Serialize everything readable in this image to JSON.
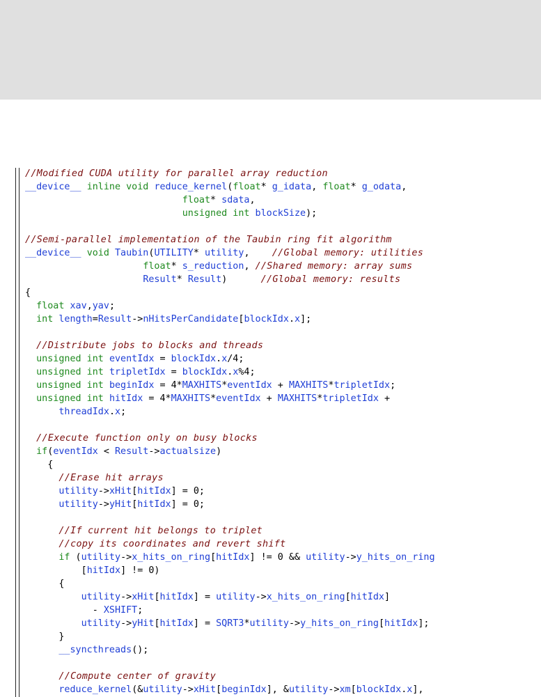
{
  "code": {
    "lines": [
      [
        {
          "c": "cmt",
          "t": "//Modified CUDA utility for parallel array reduction"
        }
      ],
      [
        {
          "c": "id",
          "t": "__device__"
        },
        {
          "c": "tx",
          "t": " "
        },
        {
          "c": "kw",
          "t": "inline void"
        },
        {
          "c": "tx",
          "t": " "
        },
        {
          "c": "id",
          "t": "reduce_kernel"
        },
        {
          "c": "tx",
          "t": "("
        },
        {
          "c": "kw",
          "t": "float"
        },
        {
          "c": "tx",
          "t": "* "
        },
        {
          "c": "id",
          "t": "g_idata"
        },
        {
          "c": "tx",
          "t": ", "
        },
        {
          "c": "kw",
          "t": "float"
        },
        {
          "c": "tx",
          "t": "* "
        },
        {
          "c": "id",
          "t": "g_odata"
        },
        {
          "c": "tx",
          "t": ","
        }
      ],
      [
        {
          "c": "tx",
          "t": "                            "
        },
        {
          "c": "kw",
          "t": "float"
        },
        {
          "c": "tx",
          "t": "* "
        },
        {
          "c": "id",
          "t": "sdata"
        },
        {
          "c": "tx",
          "t": ","
        }
      ],
      [
        {
          "c": "tx",
          "t": "                            "
        },
        {
          "c": "kw",
          "t": "unsigned int"
        },
        {
          "c": "tx",
          "t": " "
        },
        {
          "c": "id",
          "t": "blockSize"
        },
        {
          "c": "tx",
          "t": ");"
        }
      ],
      [],
      [
        {
          "c": "cmt",
          "t": "//Semi-parallel implementation of the Taubin ring fit algorithm"
        }
      ],
      [
        {
          "c": "id",
          "t": "__device__"
        },
        {
          "c": "tx",
          "t": " "
        },
        {
          "c": "kw",
          "t": "void"
        },
        {
          "c": "tx",
          "t": " "
        },
        {
          "c": "id",
          "t": "Taubin"
        },
        {
          "c": "tx",
          "t": "("
        },
        {
          "c": "id",
          "t": "UTILITY"
        },
        {
          "c": "tx",
          "t": "* "
        },
        {
          "c": "id",
          "t": "utility"
        },
        {
          "c": "tx",
          "t": ",    "
        },
        {
          "c": "cmt",
          "t": "//Global memory: utilities"
        }
      ],
      [
        {
          "c": "tx",
          "t": "                     "
        },
        {
          "c": "kw",
          "t": "float"
        },
        {
          "c": "tx",
          "t": "* "
        },
        {
          "c": "id",
          "t": "s_reduction"
        },
        {
          "c": "tx",
          "t": ", "
        },
        {
          "c": "cmt",
          "t": "//Shared memory: array sums"
        }
      ],
      [
        {
          "c": "tx",
          "t": "                     "
        },
        {
          "c": "id",
          "t": "Result"
        },
        {
          "c": "tx",
          "t": "* "
        },
        {
          "c": "id",
          "t": "Result"
        },
        {
          "c": "tx",
          "t": ")      "
        },
        {
          "c": "cmt",
          "t": "//Global memory: results"
        }
      ],
      [
        {
          "c": "tx",
          "t": "{"
        }
      ],
      [
        {
          "c": "tx",
          "t": "  "
        },
        {
          "c": "kw",
          "t": "float"
        },
        {
          "c": "tx",
          "t": " "
        },
        {
          "c": "id",
          "t": "xav"
        },
        {
          "c": "tx",
          "t": ","
        },
        {
          "c": "id",
          "t": "yav"
        },
        {
          "c": "tx",
          "t": ";"
        }
      ],
      [
        {
          "c": "tx",
          "t": "  "
        },
        {
          "c": "kw",
          "t": "int"
        },
        {
          "c": "tx",
          "t": " "
        },
        {
          "c": "id",
          "t": "length"
        },
        {
          "c": "tx",
          "t": "="
        },
        {
          "c": "id",
          "t": "Result"
        },
        {
          "c": "tx",
          "t": "->"
        },
        {
          "c": "id",
          "t": "nHitsPerCandidate"
        },
        {
          "c": "tx",
          "t": "["
        },
        {
          "c": "id",
          "t": "blockIdx"
        },
        {
          "c": "tx",
          "t": "."
        },
        {
          "c": "id",
          "t": "x"
        },
        {
          "c": "tx",
          "t": "];"
        }
      ],
      [],
      [
        {
          "c": "tx",
          "t": "  "
        },
        {
          "c": "cmt",
          "t": "//Distribute jobs to blocks and threads"
        }
      ],
      [
        {
          "c": "tx",
          "t": "  "
        },
        {
          "c": "kw",
          "t": "unsigned int"
        },
        {
          "c": "tx",
          "t": " "
        },
        {
          "c": "id",
          "t": "eventIdx"
        },
        {
          "c": "tx",
          "t": " = "
        },
        {
          "c": "id",
          "t": "blockIdx"
        },
        {
          "c": "tx",
          "t": "."
        },
        {
          "c": "id",
          "t": "x"
        },
        {
          "c": "tx",
          "t": "/4;"
        }
      ],
      [
        {
          "c": "tx",
          "t": "  "
        },
        {
          "c": "kw",
          "t": "unsigned int"
        },
        {
          "c": "tx",
          "t": " "
        },
        {
          "c": "id",
          "t": "tripletIdx"
        },
        {
          "c": "tx",
          "t": " = "
        },
        {
          "c": "id",
          "t": "blockIdx"
        },
        {
          "c": "tx",
          "t": "."
        },
        {
          "c": "id",
          "t": "x"
        },
        {
          "c": "tx",
          "t": "%4;"
        }
      ],
      [
        {
          "c": "tx",
          "t": "  "
        },
        {
          "c": "kw",
          "t": "unsigned int"
        },
        {
          "c": "tx",
          "t": " "
        },
        {
          "c": "id",
          "t": "beginIdx"
        },
        {
          "c": "tx",
          "t": " = 4*"
        },
        {
          "c": "id",
          "t": "MAXHITS"
        },
        {
          "c": "tx",
          "t": "*"
        },
        {
          "c": "id",
          "t": "eventIdx"
        },
        {
          "c": "tx",
          "t": " + "
        },
        {
          "c": "id",
          "t": "MAXHITS"
        },
        {
          "c": "tx",
          "t": "*"
        },
        {
          "c": "id",
          "t": "tripletIdx"
        },
        {
          "c": "tx",
          "t": ";"
        }
      ],
      [
        {
          "c": "tx",
          "t": "  "
        },
        {
          "c": "kw",
          "t": "unsigned int"
        },
        {
          "c": "tx",
          "t": " "
        },
        {
          "c": "id",
          "t": "hitIdx"
        },
        {
          "c": "tx",
          "t": " = 4*"
        },
        {
          "c": "id",
          "t": "MAXHITS"
        },
        {
          "c": "tx",
          "t": "*"
        },
        {
          "c": "id",
          "t": "eventIdx"
        },
        {
          "c": "tx",
          "t": " + "
        },
        {
          "c": "id",
          "t": "MAXHITS"
        },
        {
          "c": "tx",
          "t": "*"
        },
        {
          "c": "id",
          "t": "tripletIdx"
        },
        {
          "c": "tx",
          "t": " +"
        }
      ],
      [
        {
          "c": "tx",
          "t": "      "
        },
        {
          "c": "id",
          "t": "threadIdx"
        },
        {
          "c": "tx",
          "t": "."
        },
        {
          "c": "id",
          "t": "x"
        },
        {
          "c": "tx",
          "t": ";"
        }
      ],
      [],
      [
        {
          "c": "tx",
          "t": "  "
        },
        {
          "c": "cmt",
          "t": "//Execute function only on busy blocks"
        }
      ],
      [
        {
          "c": "tx",
          "t": "  "
        },
        {
          "c": "kw",
          "t": "if"
        },
        {
          "c": "tx",
          "t": "("
        },
        {
          "c": "id",
          "t": "eventIdx"
        },
        {
          "c": "tx",
          "t": " < "
        },
        {
          "c": "id",
          "t": "Result"
        },
        {
          "c": "tx",
          "t": "->"
        },
        {
          "c": "id",
          "t": "actualsize"
        },
        {
          "c": "tx",
          "t": ")"
        }
      ],
      [
        {
          "c": "tx",
          "t": "    {"
        }
      ],
      [
        {
          "c": "tx",
          "t": "      "
        },
        {
          "c": "cmt",
          "t": "//Erase hit arrays"
        }
      ],
      [
        {
          "c": "tx",
          "t": "      "
        },
        {
          "c": "id",
          "t": "utility"
        },
        {
          "c": "tx",
          "t": "->"
        },
        {
          "c": "id",
          "t": "xHit"
        },
        {
          "c": "tx",
          "t": "["
        },
        {
          "c": "id",
          "t": "hitIdx"
        },
        {
          "c": "tx",
          "t": "] = 0;"
        }
      ],
      [
        {
          "c": "tx",
          "t": "      "
        },
        {
          "c": "id",
          "t": "utility"
        },
        {
          "c": "tx",
          "t": "->"
        },
        {
          "c": "id",
          "t": "yHit"
        },
        {
          "c": "tx",
          "t": "["
        },
        {
          "c": "id",
          "t": "hitIdx"
        },
        {
          "c": "tx",
          "t": "] = 0;"
        }
      ],
      [],
      [
        {
          "c": "tx",
          "t": "      "
        },
        {
          "c": "cmt",
          "t": "//If current hit belongs to triplet"
        }
      ],
      [
        {
          "c": "tx",
          "t": "      "
        },
        {
          "c": "cmt",
          "t": "//copy its coordinates and revert shift"
        }
      ],
      [
        {
          "c": "tx",
          "t": "      "
        },
        {
          "c": "kw",
          "t": "if"
        },
        {
          "c": "tx",
          "t": " ("
        },
        {
          "c": "id",
          "t": "utility"
        },
        {
          "c": "tx",
          "t": "->"
        },
        {
          "c": "id",
          "t": "x_hits_on_ring"
        },
        {
          "c": "tx",
          "t": "["
        },
        {
          "c": "id",
          "t": "hitIdx"
        },
        {
          "c": "tx",
          "t": "] != 0 && "
        },
        {
          "c": "id",
          "t": "utility"
        },
        {
          "c": "tx",
          "t": "->"
        },
        {
          "c": "id",
          "t": "y_hits_on_ring"
        }
      ],
      [
        {
          "c": "tx",
          "t": "          ["
        },
        {
          "c": "id",
          "t": "hitIdx"
        },
        {
          "c": "tx",
          "t": "] != 0)"
        }
      ],
      [
        {
          "c": "tx",
          "t": "      {"
        }
      ],
      [
        {
          "c": "tx",
          "t": "          "
        },
        {
          "c": "id",
          "t": "utility"
        },
        {
          "c": "tx",
          "t": "->"
        },
        {
          "c": "id",
          "t": "xHit"
        },
        {
          "c": "tx",
          "t": "["
        },
        {
          "c": "id",
          "t": "hitIdx"
        },
        {
          "c": "tx",
          "t": "] = "
        },
        {
          "c": "id",
          "t": "utility"
        },
        {
          "c": "tx",
          "t": "->"
        },
        {
          "c": "id",
          "t": "x_hits_on_ring"
        },
        {
          "c": "tx",
          "t": "["
        },
        {
          "c": "id",
          "t": "hitIdx"
        },
        {
          "c": "tx",
          "t": "]"
        }
      ],
      [
        {
          "c": "tx",
          "t": "            - "
        },
        {
          "c": "id",
          "t": "XSHIFT"
        },
        {
          "c": "tx",
          "t": ";"
        }
      ],
      [
        {
          "c": "tx",
          "t": "          "
        },
        {
          "c": "id",
          "t": "utility"
        },
        {
          "c": "tx",
          "t": "->"
        },
        {
          "c": "id",
          "t": "yHit"
        },
        {
          "c": "tx",
          "t": "["
        },
        {
          "c": "id",
          "t": "hitIdx"
        },
        {
          "c": "tx",
          "t": "] = "
        },
        {
          "c": "id",
          "t": "SQRT3"
        },
        {
          "c": "tx",
          "t": "*"
        },
        {
          "c": "id",
          "t": "utility"
        },
        {
          "c": "tx",
          "t": "->"
        },
        {
          "c": "id",
          "t": "y_hits_on_ring"
        },
        {
          "c": "tx",
          "t": "["
        },
        {
          "c": "id",
          "t": "hitIdx"
        },
        {
          "c": "tx",
          "t": "];"
        }
      ],
      [
        {
          "c": "tx",
          "t": "      }"
        }
      ],
      [
        {
          "c": "tx",
          "t": "      "
        },
        {
          "c": "id",
          "t": "__syncthreads"
        },
        {
          "c": "tx",
          "t": "();"
        }
      ],
      [],
      [
        {
          "c": "tx",
          "t": "      "
        },
        {
          "c": "cmt",
          "t": "//Compute center of gravity"
        }
      ],
      [
        {
          "c": "tx",
          "t": "      "
        },
        {
          "c": "id",
          "t": "reduce_kernel"
        },
        {
          "c": "tx",
          "t": "(&"
        },
        {
          "c": "id",
          "t": "utility"
        },
        {
          "c": "tx",
          "t": "->"
        },
        {
          "c": "id",
          "t": "xHit"
        },
        {
          "c": "tx",
          "t": "["
        },
        {
          "c": "id",
          "t": "beginIdx"
        },
        {
          "c": "tx",
          "t": "], &"
        },
        {
          "c": "id",
          "t": "utility"
        },
        {
          "c": "tx",
          "t": "->"
        },
        {
          "c": "id",
          "t": "xm"
        },
        {
          "c": "tx",
          "t": "["
        },
        {
          "c": "id",
          "t": "blockIdx"
        },
        {
          "c": "tx",
          "t": "."
        },
        {
          "c": "id",
          "t": "x"
        },
        {
          "c": "tx",
          "t": "],"
        }
      ]
    ]
  },
  "colors": {
    "comment": "#7a1010",
    "keyword": "#1f8a1f",
    "identifier": "#1f3fd6",
    "text": "#000000",
    "top_band": "#e0e0e0"
  }
}
